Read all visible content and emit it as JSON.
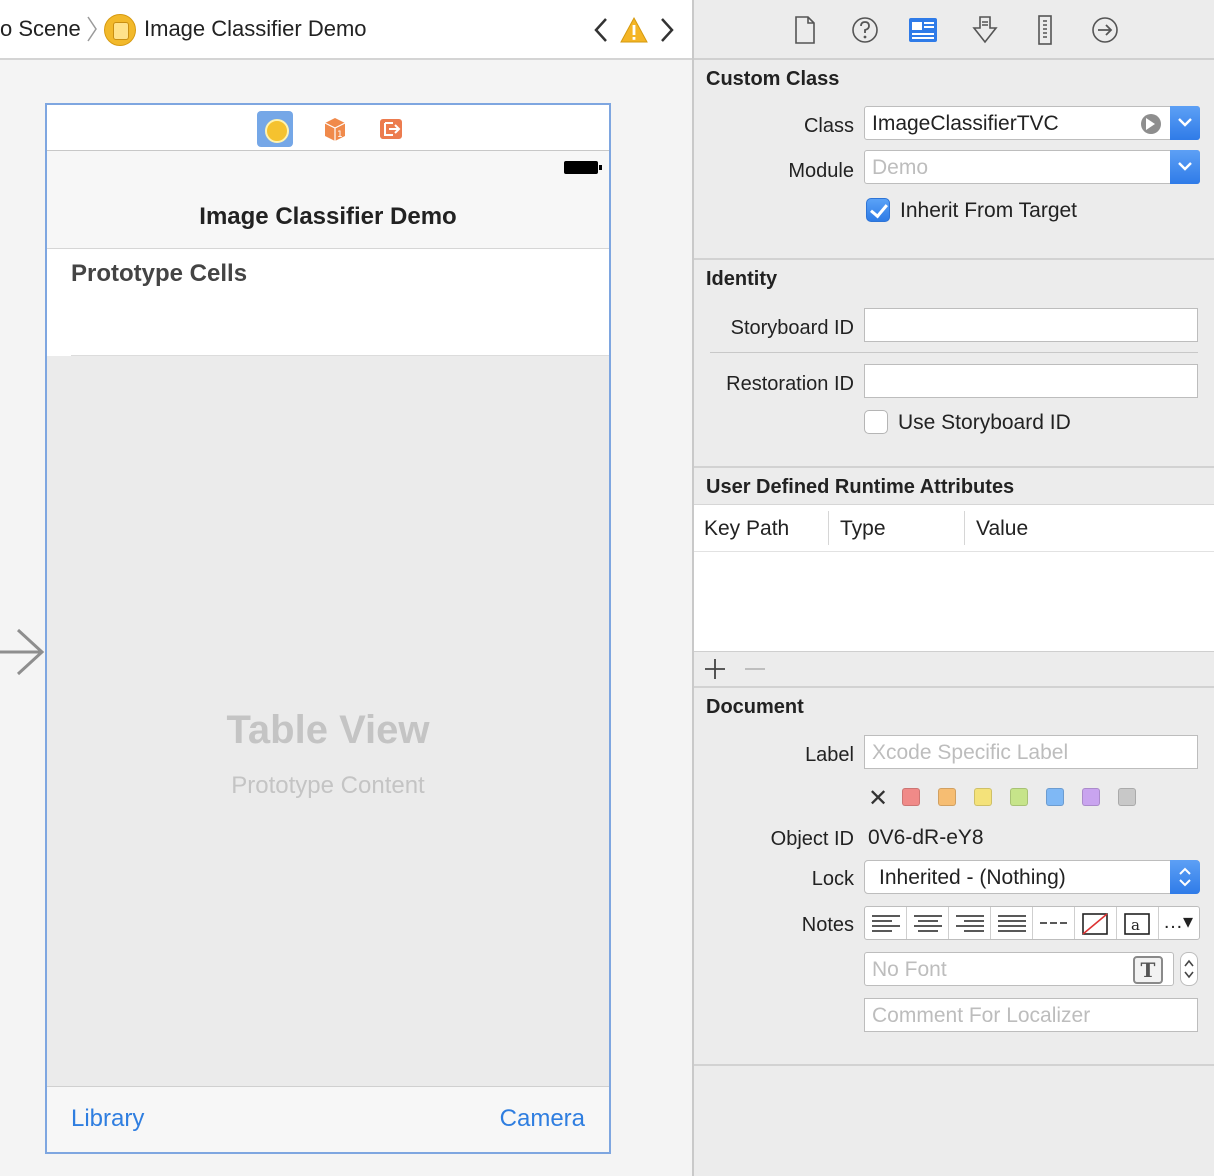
{
  "jumpbar": {
    "crumb_scene": "o Scene",
    "crumb_controller": "Image Classifier Demo"
  },
  "scene": {
    "nav_title": "Image Classifier Demo",
    "prototype_header": "Prototype Cells",
    "table_view_title": "Table View",
    "table_view_subtitle": "Prototype Content",
    "toolbar_left": "Library",
    "toolbar_right": "Camera"
  },
  "inspector": {
    "custom_class": {
      "title": "Custom Class",
      "class_label": "Class",
      "class_value": "ImageClassifierTVC",
      "module_label": "Module",
      "module_placeholder": "Demo",
      "inherit_label": "Inherit From Target",
      "inherit_checked": true
    },
    "identity": {
      "title": "Identity",
      "storyboard_id_label": "Storyboard ID",
      "storyboard_id_value": "",
      "restoration_id_label": "Restoration ID",
      "restoration_id_value": "",
      "use_storyboard_id_label": "Use Storyboard ID",
      "use_storyboard_id_checked": false
    },
    "udra": {
      "title": "User Defined Runtime Attributes",
      "columns": [
        "Key Path",
        "Type",
        "Value"
      ]
    },
    "document": {
      "title": "Document",
      "label_label": "Label",
      "label_placeholder": "Xcode Specific Label",
      "swatch_colors": [
        "#f08a88",
        "#f6bd72",
        "#f4e27a",
        "#c6e48a",
        "#7fb8f5",
        "#c9a4ef",
        "#c8c8c8"
      ],
      "object_id_label": "Object ID",
      "object_id_value": "0V6-dR-eY8",
      "lock_label": "Lock",
      "lock_value": "Inherited - (Nothing)",
      "notes_label": "Notes",
      "font_placeholder": "No Font",
      "font_icon_letter": "T",
      "comment_placeholder": "Comment For Localizer"
    }
  },
  "colors": {
    "accent_blue": "#2f7be8",
    "link_blue": "#2f7ee0",
    "scene_border": "#7ea6e0"
  }
}
